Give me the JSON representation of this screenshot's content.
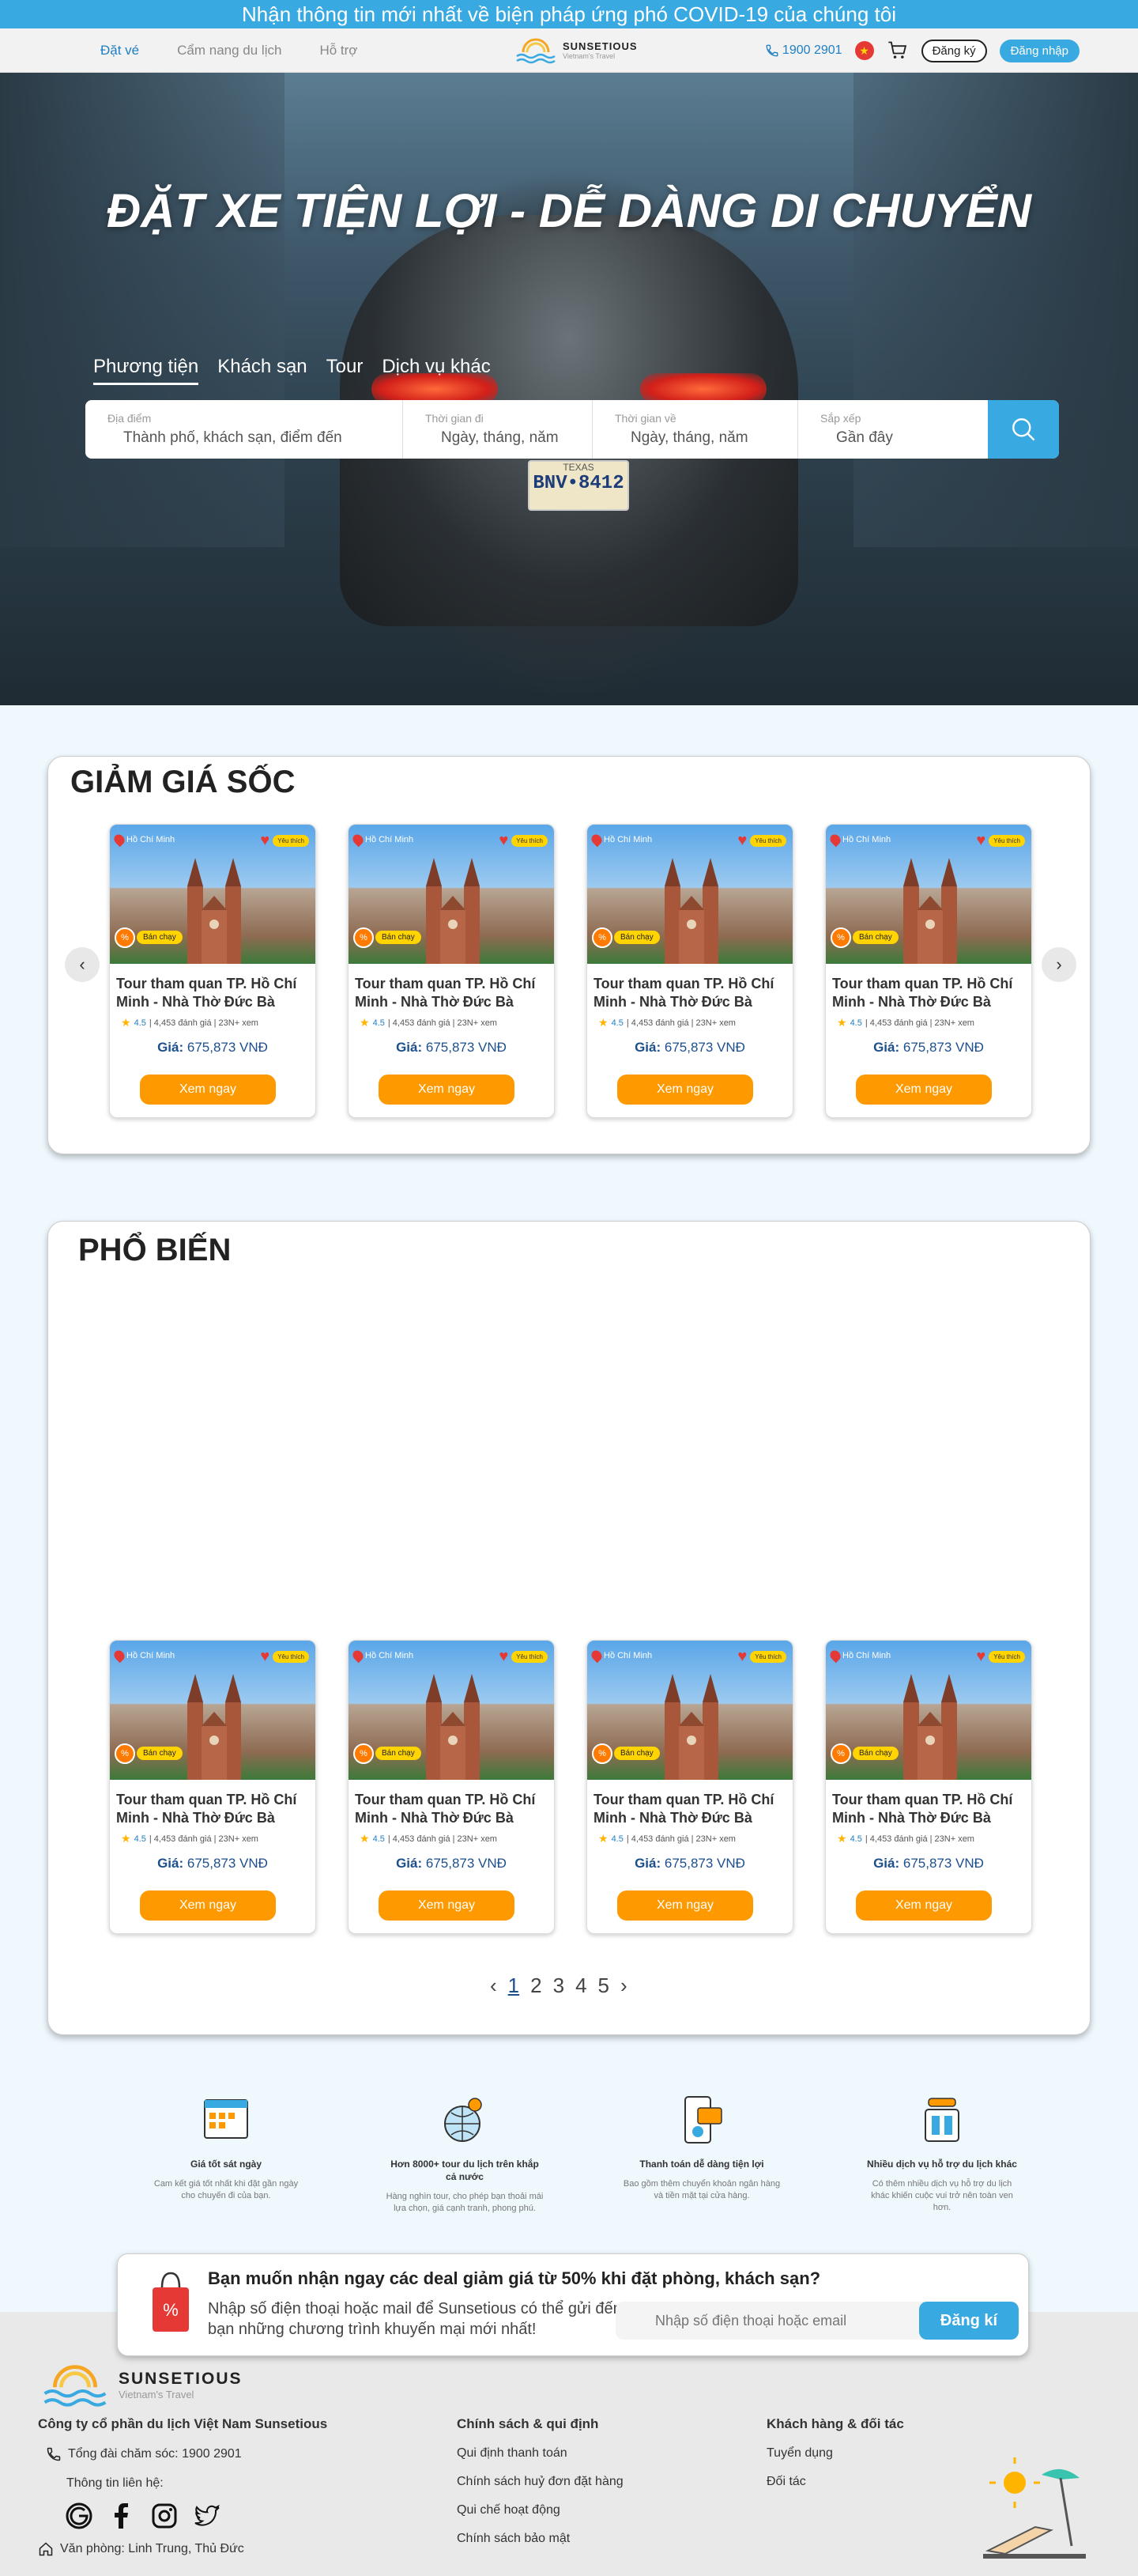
{
  "announcement": "Nhận thông tin mới nhất về biện pháp ứng phó COVID-19 của chúng tôi",
  "header": {
    "nav": [
      "Đặt vé",
      "Cẩm nang du lịch",
      "Hỗ trợ"
    ],
    "logo_name": "SUNSETIOUS",
    "logo_sub": "Vietnam's Travel",
    "phone": "1900 2901",
    "register": "Đăng ký",
    "login": "Đăng nhập"
  },
  "hero": {
    "title": "ĐẶT XE TIỆN LỢI - DỄ DÀNG DI CHUYỂN",
    "tabs": [
      "Phương tiện",
      "Khách sạn",
      "Tour",
      "Dịch vụ khác"
    ],
    "plate_state": "TEXAS",
    "plate_number": "BNV•8412",
    "search": [
      {
        "label": "Địa điểm",
        "placeholder": "Thành phố, khách sạn, điểm đến"
      },
      {
        "label": "Thời gian đi",
        "placeholder": "Ngày, tháng, năm"
      },
      {
        "label": "Thời gian về",
        "placeholder": "Ngày, tháng, năm"
      },
      {
        "label": "Sắp xếp",
        "placeholder": "Gần đây"
      }
    ]
  },
  "sale": {
    "title": "GIẢM GIÁ SỐC"
  },
  "popular": {
    "title": "PHỔ BIẾN",
    "pages": [
      "1",
      "2",
      "3",
      "4",
      "5"
    ]
  },
  "card": {
    "location": "Hồ Chí Minh",
    "fav_tag": "Yêu thích",
    "pct": "%",
    "hot": "Bán chạy",
    "name": "Tour tham quan TP. Hồ Chí Minh - Nhà Thờ Đức Bà",
    "rating": "4.5",
    "meta": "| 4,453 đánh giá | 23N+ xem",
    "price_label": "Giá:",
    "price": "675,873 VNĐ",
    "button": "Xem ngay"
  },
  "features": [
    {
      "title": "Giá tốt sát ngày",
      "desc": "Cam kết giá tốt nhất khi đặt gần ngày cho chuyến đi của bạn."
    },
    {
      "title": "Hơn 8000+ tour du lịch trên khắp cả nước",
      "desc": "Hàng nghìn tour, cho phép bạn thoải mái lựa chọn, giá cạnh tranh, phong phú."
    },
    {
      "title": "Thanh toán dễ dàng tiện lợi",
      "desc": "Bao gồm thêm chuyển khoản ngân hàng và tiền mặt tại cửa hàng."
    },
    {
      "title": "Nhiều dịch vụ hỗ trợ du lịch khác",
      "desc": "Có thêm nhiều dịch vụ hỗ trợ du lịch khác khiến cuộc vui trở nên toàn ven hơn."
    }
  ],
  "newsletter": {
    "title": "Bạn muốn nhận ngay các deal giảm giá từ 50% khi đặt phòng, khách sạn?",
    "desc": "Nhập số điện thoại hoặc mail để Sunsetious có thể gửi đến bạn những chương trình khuyến mại mới nhất!",
    "placeholder": "Nhập số điện thoại hoặc email",
    "button": "Đăng kí"
  },
  "footer": {
    "logo_name": "SUNSETIOUS",
    "logo_sub": "Vietnam's Travel",
    "company": "Công ty cổ phần du lịch Việt Nam Sunsetious",
    "hotline": "Tổng đài chăm sóc: 1900 2901",
    "contact": "Thông tin liên hệ:",
    "office": "Văn phòng: Linh Trung, Thủ Đức",
    "policy_title": "Chính sách & qui định",
    "policies": [
      "Qui định thanh toán",
      "Chính sách huỷ đơn đặt hàng",
      "Qui chế hoạt động",
      "Chính sách bảo mật"
    ],
    "partner_title": "Khách hàng & đối tác",
    "partners": [
      "Tuyển dụng",
      "Đối tác"
    ]
  }
}
